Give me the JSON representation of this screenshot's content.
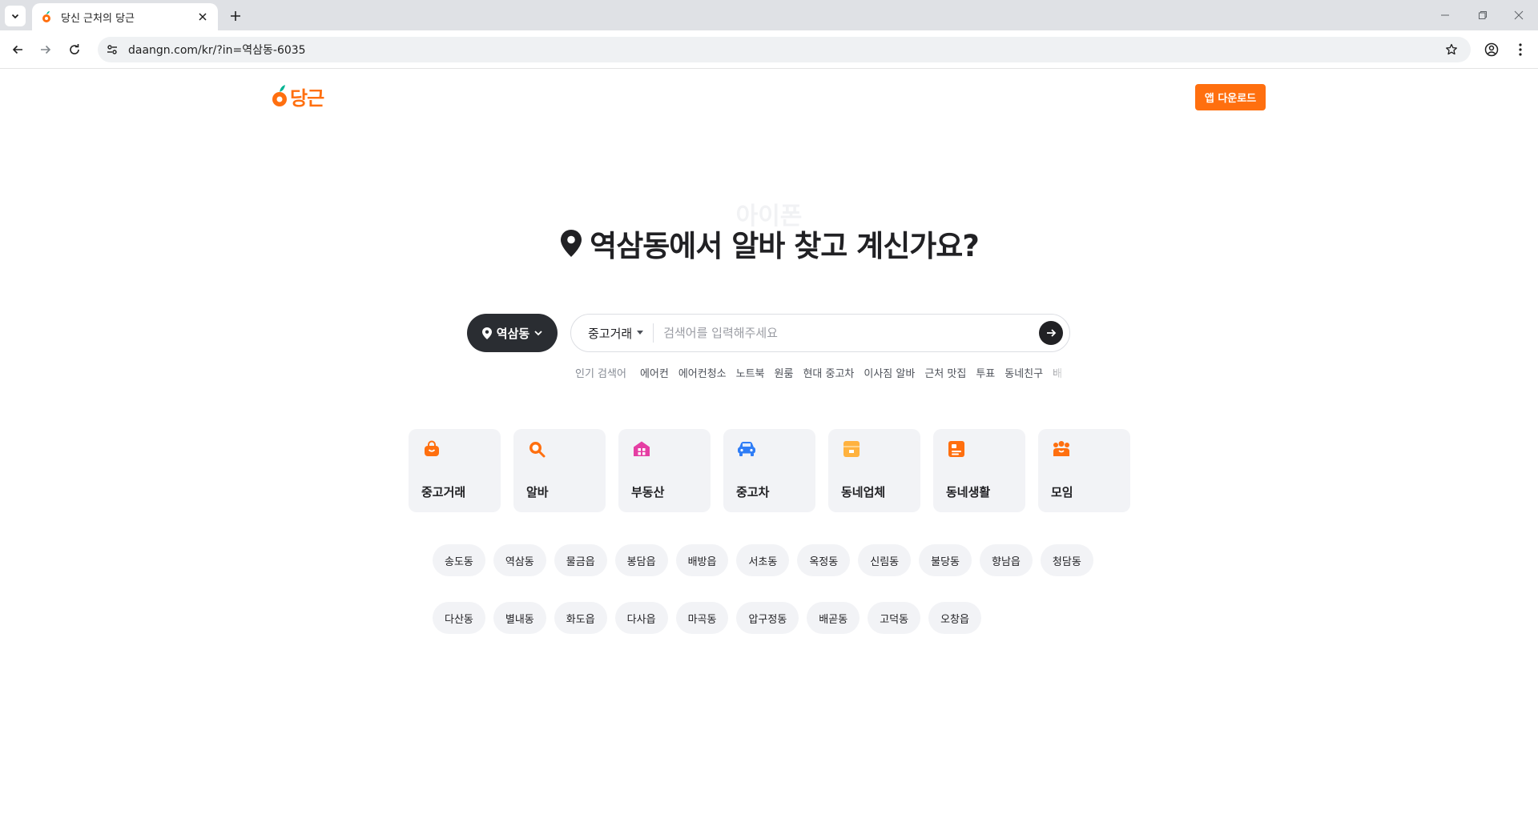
{
  "browser": {
    "tab_title": "당신 근처의 당근",
    "url": "daangn.com/kr/?in=역삼동-6035"
  },
  "header": {
    "logo_text": "당근",
    "app_download_label": "앱 다운로드"
  },
  "hero": {
    "rolling_word": "아이폰",
    "title": "역삼동에서 알바 찾고 계신가요?"
  },
  "search": {
    "location_label": "역삼동",
    "category_label": "중고거래",
    "placeholder": "검색어를 입력해주세요",
    "popular_label": "인기 검색어",
    "popular_keywords": [
      "에어컨",
      "에어컨청소",
      "노트북",
      "원룸",
      "현대 중고차",
      "이사짐 알바",
      "근처 맛집",
      "투표",
      "동네친구",
      "배"
    ]
  },
  "categories": [
    {
      "label": "중고거래",
      "icon": "shopping-bag-icon",
      "color": "#ff6f0f"
    },
    {
      "label": "알바",
      "icon": "magnifier-icon",
      "color": "#ff6f0f"
    },
    {
      "label": "부동산",
      "icon": "house-icon",
      "color": "#e53ea3"
    },
    {
      "label": "중고차",
      "icon": "car-icon",
      "color": "#2f7df6"
    },
    {
      "label": "동네업체",
      "icon": "store-icon",
      "color": "#ffb23f"
    },
    {
      "label": "동네생활",
      "icon": "board-icon",
      "color": "#ff6f0f"
    },
    {
      "label": "모임",
      "icon": "group-icon",
      "color": "#ff6f0f"
    }
  ],
  "regions": {
    "row1": [
      "송도동",
      "역삼동",
      "물금읍",
      "봉담읍",
      "배방읍",
      "서초동",
      "옥정동",
      "신림동",
      "불당동",
      "향남읍",
      "청담동"
    ],
    "row2": [
      "다산동",
      "별내동",
      "화도읍",
      "다사읍",
      "마곡동",
      "압구정동",
      "배곧동",
      "고덕동",
      "오창읍"
    ]
  },
  "colors": {
    "brand": "#ff6f0f",
    "dark": "#212124",
    "chip_bg": "#f2f3f6"
  }
}
